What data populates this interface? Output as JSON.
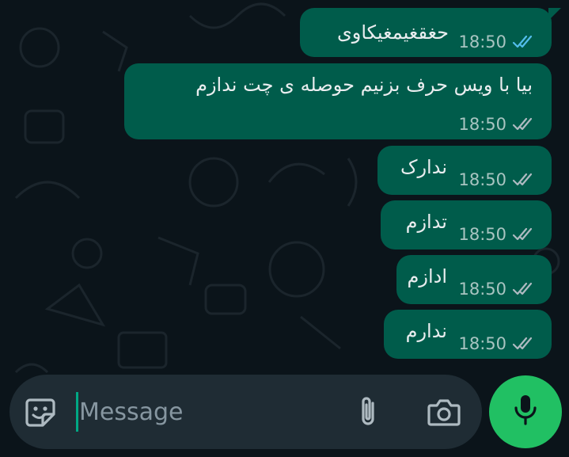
{
  "colors": {
    "background": "#0b141a",
    "outgoing_bubble": "#005c4b",
    "text": "#e9edef",
    "read_tick_blue": "#53bdeb",
    "delivered_tick_gray": "#aebac1",
    "input_bar": "#1f2c34",
    "mic_button": "#21c063"
  },
  "messages": [
    {
      "text": "حغقغیمغیکاوی",
      "time": "18:50",
      "status": "read",
      "tick_icon": "double-check-blue-icon"
    },
    {
      "text": "بیا با ویس حرف بزنیم حوصله ی چت ندازم",
      "time": "18:50",
      "status": "delivered",
      "tick_icon": "double-check-gray-icon"
    },
    {
      "text": "ندارک",
      "time": "18:50",
      "status": "delivered",
      "tick_icon": "double-check-gray-icon"
    },
    {
      "text": "تدازم",
      "time": "18:50",
      "status": "delivered",
      "tick_icon": "double-check-gray-icon"
    },
    {
      "text": "ادازم",
      "time": "18:50",
      "status": "delivered",
      "tick_icon": "double-check-gray-icon"
    },
    {
      "text": "ندارم",
      "time": "18:50",
      "status": "delivered",
      "tick_icon": "double-check-gray-icon"
    }
  ],
  "composer": {
    "placeholder": "Message",
    "value": "",
    "icons": [
      "sticker-icon",
      "attach-icon",
      "camera-icon",
      "mic-icon"
    ]
  }
}
